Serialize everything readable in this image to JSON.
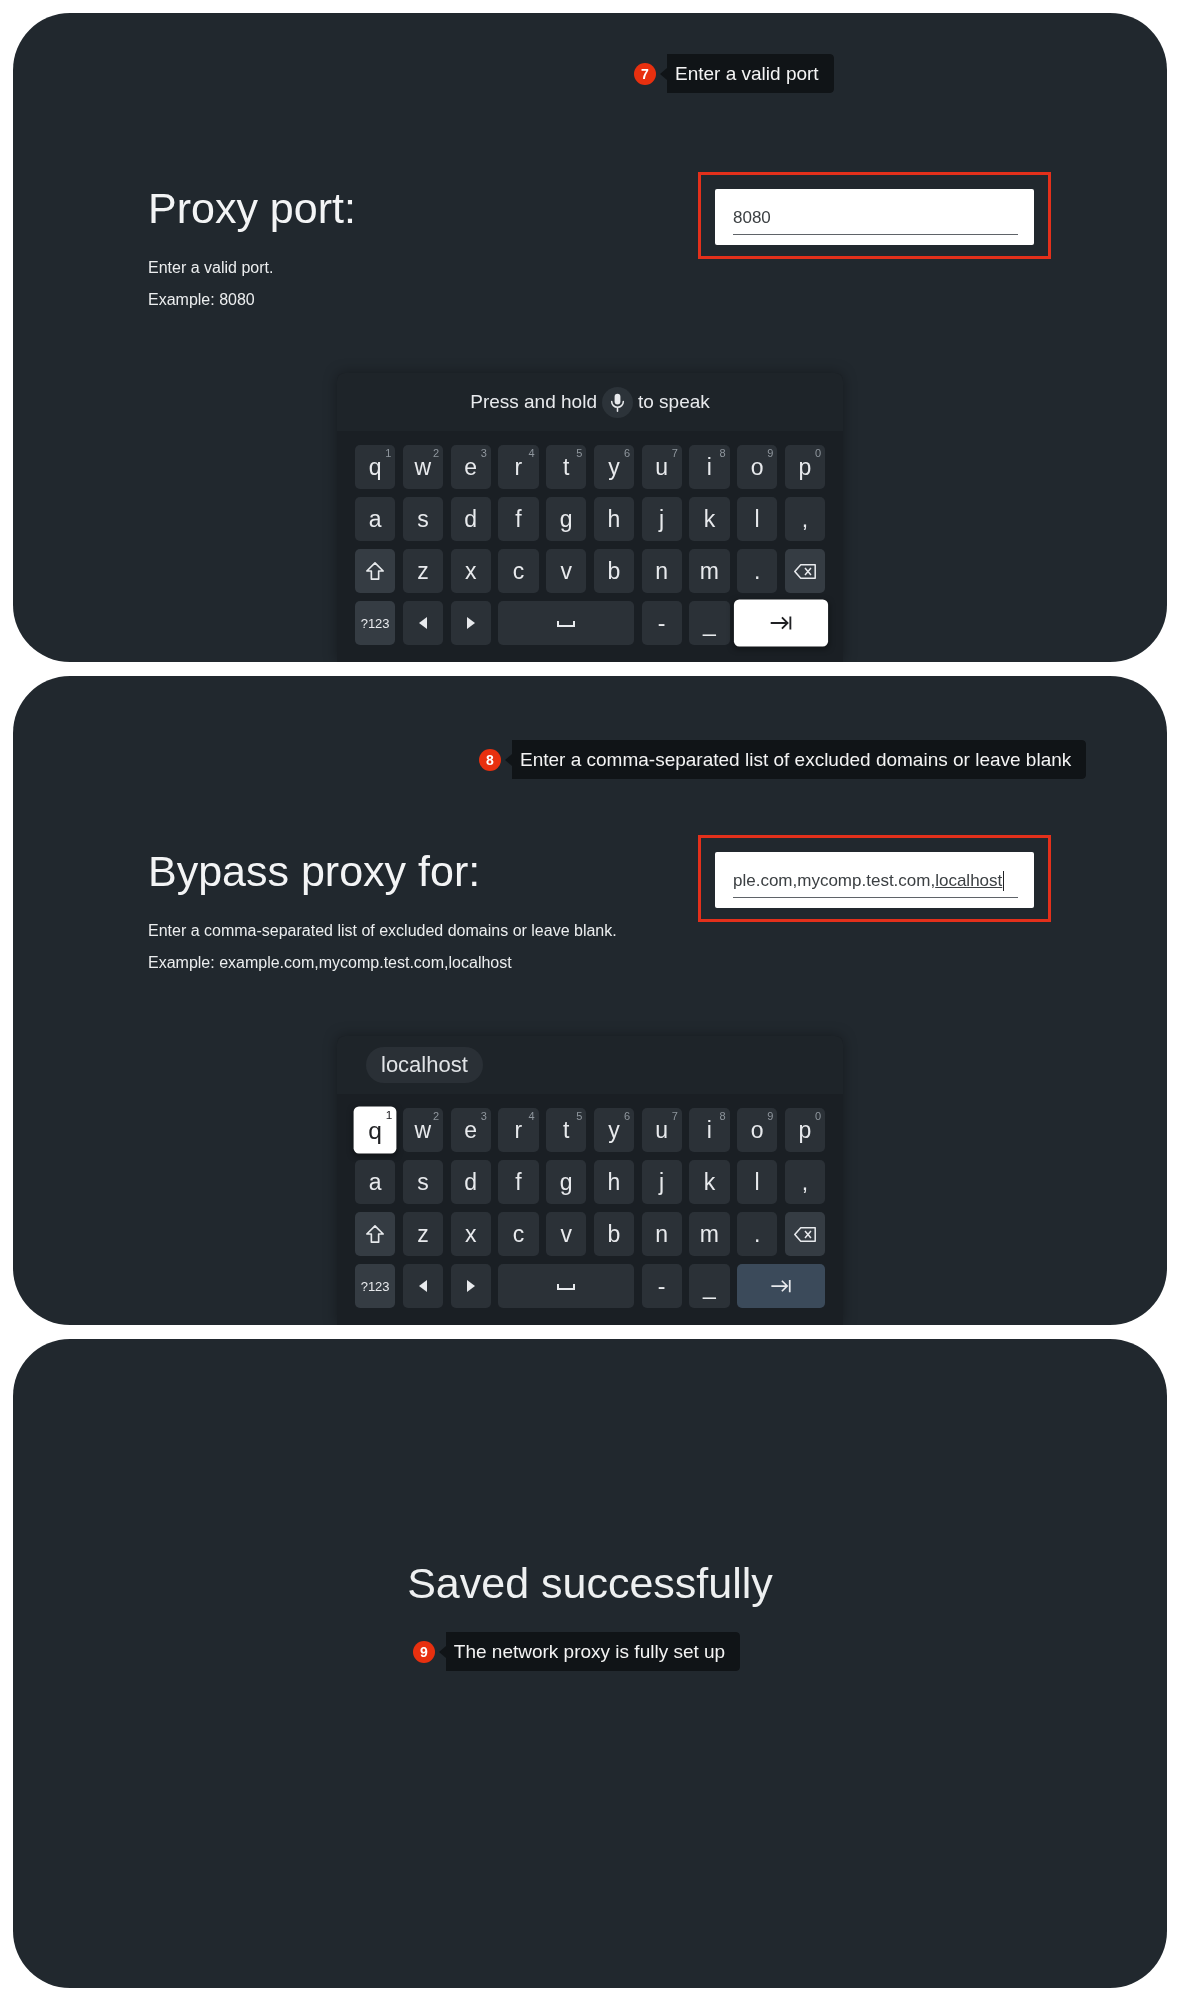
{
  "panels": [
    {
      "kind": "form",
      "callout": {
        "step": "7",
        "text": "Enter a valid port"
      },
      "title": "Proxy port:",
      "description": [
        "Enter a valid port.",
        "Example: 8080"
      ],
      "field": {
        "value": "8080",
        "highlighted": true,
        "caret": false
      },
      "keyboard": {
        "header": {
          "kind": "voice",
          "before": "Press and hold",
          "after": "to speak"
        },
        "rows": [
          {
            "keys": [
              {
                "kind": "char",
                "label": "q",
                "hint": "1",
                "focused": false
              },
              {
                "kind": "char",
                "label": "w",
                "hint": "2",
                "focused": false
              },
              {
                "kind": "char",
                "label": "e",
                "hint": "3",
                "focused": false
              },
              {
                "kind": "char",
                "label": "r",
                "hint": "4",
                "focused": false
              },
              {
                "kind": "char",
                "label": "t",
                "hint": "5",
                "focused": false
              },
              {
                "kind": "char",
                "label": "y",
                "hint": "6",
                "focused": false
              },
              {
                "kind": "char",
                "label": "u",
                "hint": "7",
                "focused": false
              },
              {
                "kind": "char",
                "label": "i",
                "hint": "8",
                "focused": false
              },
              {
                "kind": "char",
                "label": "o",
                "hint": "9",
                "focused": false
              },
              {
                "kind": "char",
                "label": "p",
                "hint": "0",
                "focused": false
              }
            ]
          },
          {
            "keys": [
              {
                "kind": "char",
                "label": "a",
                "focused": false
              },
              {
                "kind": "char",
                "label": "s",
                "focused": false
              },
              {
                "kind": "char",
                "label": "d",
                "focused": false
              },
              {
                "kind": "char",
                "label": "f",
                "focused": false
              },
              {
                "kind": "char",
                "label": "g",
                "focused": false
              },
              {
                "kind": "char",
                "label": "h",
                "focused": false
              },
              {
                "kind": "char",
                "label": "j",
                "focused": false
              },
              {
                "kind": "char",
                "label": "k",
                "focused": false
              },
              {
                "kind": "char",
                "label": "l",
                "focused": false
              },
              {
                "kind": "char",
                "label": ",",
                "focused": false
              }
            ]
          },
          {
            "keys": [
              {
                "kind": "shift",
                "focused": false
              },
              {
                "kind": "char",
                "label": "z",
                "focused": false
              },
              {
                "kind": "char",
                "label": "x",
                "focused": false
              },
              {
                "kind": "char",
                "label": "c",
                "focused": false
              },
              {
                "kind": "char",
                "label": "v",
                "focused": false
              },
              {
                "kind": "char",
                "label": "b",
                "focused": false
              },
              {
                "kind": "char",
                "label": "n",
                "focused": false
              },
              {
                "kind": "char",
                "label": "m",
                "focused": false
              },
              {
                "kind": "char",
                "label": ".",
                "focused": false
              },
              {
                "kind": "backspace",
                "focused": false
              }
            ]
          },
          {
            "keys": [
              {
                "kind": "symbols",
                "label": "?123",
                "focused": false
              },
              {
                "kind": "left",
                "focused": false
              },
              {
                "kind": "right",
                "focused": false
              },
              {
                "kind": "space",
                "focused": false
              },
              {
                "kind": "char",
                "label": "-",
                "focused": false
              },
              {
                "kind": "char",
                "label": "_",
                "focused": false
              },
              {
                "kind": "tab",
                "focused": true
              }
            ]
          }
        ]
      }
    },
    {
      "kind": "form",
      "callout": {
        "step": "8",
        "text": "Enter a comma-separated list of excluded domains or leave blank"
      },
      "title": "Bypass proxy for:",
      "description": [
        "Enter a comma-separated list of excluded domains or leave blank.",
        "Example: example.com,mycomp.test.com,localhost"
      ],
      "field": {
        "value": "ple.com,mycomp.test.com,",
        "composing": "localhost",
        "highlighted": true,
        "caret": true
      },
      "keyboard": {
        "header": {
          "kind": "suggestions",
          "suggestions": [
            "localhost"
          ]
        },
        "rows": [
          {
            "keys": [
              {
                "kind": "char",
                "label": "q",
                "hint": "1",
                "focused": true
              },
              {
                "kind": "char",
                "label": "w",
                "hint": "2",
                "focused": false
              },
              {
                "kind": "char",
                "label": "e",
                "hint": "3",
                "focused": false
              },
              {
                "kind": "char",
                "label": "r",
                "hint": "4",
                "focused": false
              },
              {
                "kind": "char",
                "label": "t",
                "hint": "5",
                "focused": false
              },
              {
                "kind": "char",
                "label": "y",
                "hint": "6",
                "focused": false
              },
              {
                "kind": "char",
                "label": "u",
                "hint": "7",
                "focused": false
              },
              {
                "kind": "char",
                "label": "i",
                "hint": "8",
                "focused": false
              },
              {
                "kind": "char",
                "label": "o",
                "hint": "9",
                "focused": false
              },
              {
                "kind": "char",
                "label": "p",
                "hint": "0",
                "focused": false
              }
            ]
          },
          {
            "keys": [
              {
                "kind": "char",
                "label": "a",
                "focused": false
              },
              {
                "kind": "char",
                "label": "s",
                "focused": false
              },
              {
                "kind": "char",
                "label": "d",
                "focused": false
              },
              {
                "kind": "char",
                "label": "f",
                "focused": false
              },
              {
                "kind": "char",
                "label": "g",
                "focused": false
              },
              {
                "kind": "char",
                "label": "h",
                "focused": false
              },
              {
                "kind": "char",
                "label": "j",
                "focused": false
              },
              {
                "kind": "char",
                "label": "k",
                "focused": false
              },
              {
                "kind": "char",
                "label": "l",
                "focused": false
              },
              {
                "kind": "char",
                "label": ",",
                "focused": false
              }
            ]
          },
          {
            "keys": [
              {
                "kind": "shift",
                "focused": false
              },
              {
                "kind": "char",
                "label": "z",
                "focused": false
              },
              {
                "kind": "char",
                "label": "x",
                "focused": false
              },
              {
                "kind": "char",
                "label": "c",
                "focused": false
              },
              {
                "kind": "char",
                "label": "v",
                "focused": false
              },
              {
                "kind": "char",
                "label": "b",
                "focused": false
              },
              {
                "kind": "char",
                "label": "n",
                "focused": false
              },
              {
                "kind": "char",
                "label": "m",
                "focused": false
              },
              {
                "kind": "char",
                "label": ".",
                "focused": false
              },
              {
                "kind": "backspace",
                "focused": false
              }
            ]
          },
          {
            "keys": [
              {
                "kind": "symbols",
                "label": "?123",
                "focused": false
              },
              {
                "kind": "left",
                "focused": false
              },
              {
                "kind": "right",
                "focused": false
              },
              {
                "kind": "space",
                "focused": false
              },
              {
                "kind": "char",
                "label": "-",
                "focused": false
              },
              {
                "kind": "char",
                "label": "_",
                "focused": false
              },
              {
                "kind": "tab",
                "focused": false
              }
            ]
          }
        ]
      }
    },
    {
      "kind": "message",
      "title": "Saved successfully",
      "callout": {
        "step": "9",
        "text": "The network proxy is fully set up"
      }
    }
  ]
}
